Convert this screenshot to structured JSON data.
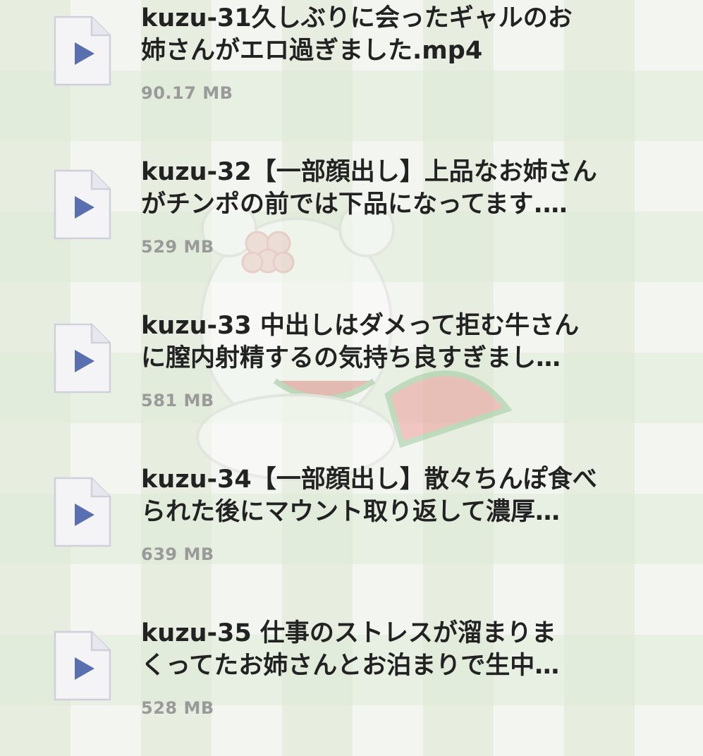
{
  "files": [
    {
      "name": "kuzu-31久しぶりに会ったギャルのお\n姉さんがエロ過ぎました.mp4",
      "size": "90.17 MB",
      "icon": "play-file-icon"
    },
    {
      "name": "kuzu-32【一部顔出し】上品なお姉さん\nがチンポの前では下品になってます.…",
      "size": "529 MB",
      "icon": "play-file-icon"
    },
    {
      "name": "kuzu-33 中出しはダメって拒む牛さん\nに膣内射精するの気持ち良すぎまし…",
      "size": "581 MB",
      "icon": "play-file-icon"
    },
    {
      "name": "kuzu-34【一部顔出し】散々ちんぽ食べ\nられた後にマウント取り返して濃厚…",
      "size": "639 MB",
      "icon": "play-file-icon"
    },
    {
      "name": "kuzu-35 仕事のストレスが溜まりま\nくってたお姉さんとお泊まりで生中…",
      "size": "528 MB",
      "icon": "play-file-icon"
    }
  ],
  "colors": {
    "icon_fill": "#f4f4f7",
    "icon_border": "#cfd0dc",
    "play": "#5a6fb0",
    "name": "#222222",
    "size": "#9a9a9a"
  }
}
